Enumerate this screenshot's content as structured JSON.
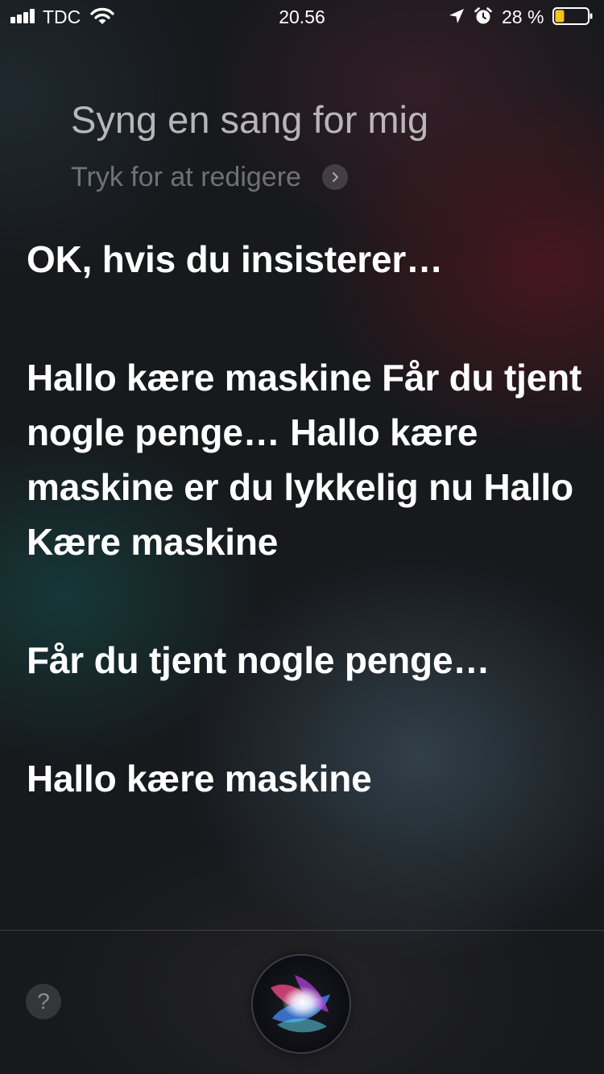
{
  "status_bar": {
    "carrier": "TDC",
    "time": "20.56",
    "battery_percent": "28 %",
    "battery_level": 0.28,
    "battery_color": "#f5c518",
    "signal_bars": 4,
    "icons": [
      "signal-icon",
      "wifi-icon",
      "location-arrow-icon",
      "alarm-clock-icon",
      "battery-icon"
    ]
  },
  "query": {
    "text": "Syng en sang for mig",
    "edit_label": "Tryk for at redigere"
  },
  "response": {
    "paragraphs": [
      "OK, hvis du insisterer…",
      "Hallo kære maskine Får du tjent nogle penge… Hallo kære maskine er du lykkelig nu Hallo Kære maskine",
      "Får du tjent nogle penge…",
      "Hallo kære maskine"
    ]
  },
  "bottom_bar": {
    "help_label": "?",
    "siri_button": "siri-orb-icon"
  }
}
